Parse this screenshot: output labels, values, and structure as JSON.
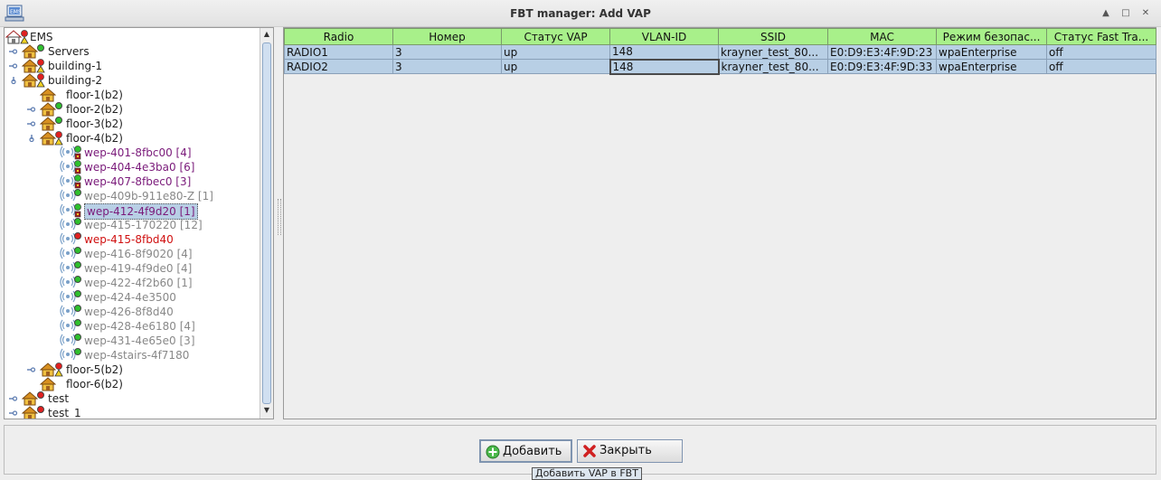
{
  "window": {
    "title": "FBT manager: Add VAP"
  },
  "tree": [
    {
      "label": "EMS",
      "level": 0,
      "icon": "building-ems-icon",
      "status": "warn",
      "color": "black",
      "toggle": "none"
    },
    {
      "label": "Servers",
      "level": 1,
      "icon": "house-icon",
      "status": "green",
      "color": "black",
      "toggle": "collapsed"
    },
    {
      "label": "building-1",
      "level": 1,
      "icon": "house-icon",
      "status": "warn",
      "color": "black",
      "toggle": "collapsed"
    },
    {
      "label": "building-2",
      "level": 1,
      "icon": "house-icon",
      "status": "warn",
      "color": "black",
      "toggle": "expanded"
    },
    {
      "label": "floor-1(b2)",
      "level": 2,
      "icon": "house-icon",
      "status": "none",
      "color": "black",
      "toggle": "none"
    },
    {
      "label": "floor-2(b2)",
      "level": 2,
      "icon": "house-icon",
      "status": "green",
      "color": "black",
      "toggle": "collapsed"
    },
    {
      "label": "floor-3(b2)",
      "level": 2,
      "icon": "house-icon",
      "status": "green",
      "color": "black",
      "toggle": "collapsed"
    },
    {
      "label": "floor-4(b2)",
      "level": 2,
      "icon": "house-icon",
      "status": "warn",
      "color": "black",
      "toggle": "expanded"
    },
    {
      "label": "wep-401-8fbc00 [4]",
      "level": 3,
      "icon": "wifi-icon",
      "status": "green-lock",
      "color": "purple",
      "toggle": "none"
    },
    {
      "label": "wep-404-4e3ba0 [6]",
      "level": 3,
      "icon": "wifi-icon",
      "status": "green-lock",
      "color": "purple",
      "toggle": "none"
    },
    {
      "label": "wep-407-8fbec0 [3]",
      "level": 3,
      "icon": "wifi-icon",
      "status": "green-lock",
      "color": "purple",
      "toggle": "none"
    },
    {
      "label": "wep-409b-911e80-Z [1]",
      "level": 3,
      "icon": "wifi-icon",
      "status": "green",
      "color": "gray",
      "toggle": "none"
    },
    {
      "label": "wep-412-4f9d20 [1]",
      "level": 3,
      "icon": "wifi-icon",
      "status": "green-lock",
      "color": "purple",
      "toggle": "none",
      "selected": true
    },
    {
      "label": "wep-415-170220 [12]",
      "level": 3,
      "icon": "wifi-icon",
      "status": "green",
      "color": "gray",
      "toggle": "none"
    },
    {
      "label": "wep-415-8fbd40",
      "level": 3,
      "icon": "wifi-icon",
      "status": "red",
      "color": "red",
      "toggle": "none"
    },
    {
      "label": "wep-416-8f9020 [4]",
      "level": 3,
      "icon": "wifi-icon",
      "status": "green",
      "color": "gray",
      "toggle": "none"
    },
    {
      "label": "wep-419-4f9de0 [4]",
      "level": 3,
      "icon": "wifi-icon",
      "status": "green",
      "color": "gray",
      "toggle": "none"
    },
    {
      "label": "wep-422-4f2b60 [1]",
      "level": 3,
      "icon": "wifi-icon",
      "status": "green",
      "color": "gray",
      "toggle": "none"
    },
    {
      "label": "wep-424-4e3500",
      "level": 3,
      "icon": "wifi-icon",
      "status": "green",
      "color": "gray",
      "toggle": "none"
    },
    {
      "label": "wep-426-8f8d40",
      "level": 3,
      "icon": "wifi-icon",
      "status": "green",
      "color": "gray",
      "toggle": "none"
    },
    {
      "label": "wep-428-4e6180 [4]",
      "level": 3,
      "icon": "wifi-icon",
      "status": "green",
      "color": "gray",
      "toggle": "none"
    },
    {
      "label": "wep-431-4e65e0 [3]",
      "level": 3,
      "icon": "wifi-icon",
      "status": "green",
      "color": "gray",
      "toggle": "none"
    },
    {
      "label": "wep-4stairs-4f7180",
      "level": 3,
      "icon": "wifi-icon",
      "status": "green",
      "color": "gray",
      "toggle": "none"
    },
    {
      "label": "floor-5(b2)",
      "level": 2,
      "icon": "house-icon",
      "status": "warn",
      "color": "black",
      "toggle": "collapsed"
    },
    {
      "label": "floor-6(b2)",
      "level": 2,
      "icon": "house-icon",
      "status": "none",
      "color": "black",
      "toggle": "none"
    },
    {
      "label": "test",
      "level": 1,
      "icon": "house-icon",
      "status": "red",
      "color": "black",
      "toggle": "collapsed"
    },
    {
      "label": "test_1",
      "level": 1,
      "icon": "house-icon",
      "status": "red",
      "color": "black",
      "toggle": "collapsed"
    }
  ],
  "table": {
    "columns": [
      "Radio",
      "Номер",
      "Статус VAP",
      "VLAN-ID",
      "SSID",
      "MAC",
      "Режим безопас...",
      "Статус Fast Tra..."
    ],
    "rows": [
      [
        "RADIO1",
        "3",
        "up",
        "148",
        "krayner_test_80...",
        "E0:D9:E3:4F:9D:23",
        "wpaEnterprise",
        "off"
      ],
      [
        "RADIO2",
        "3",
        "up",
        "148",
        "krayner_test_80...",
        "E0:D9:E3:4F:9D:33",
        "wpaEnterprise",
        "off"
      ]
    ]
  },
  "buttons": {
    "add_label": "Добавить",
    "close_label": "Закрыть"
  },
  "tooltip": "Добавить VAP в FBT",
  "colors": {
    "header_green": "#a8f08a",
    "selection_blue": "#b8cfe5",
    "status_green": "#2ec02e",
    "status_red": "#e02020"
  }
}
